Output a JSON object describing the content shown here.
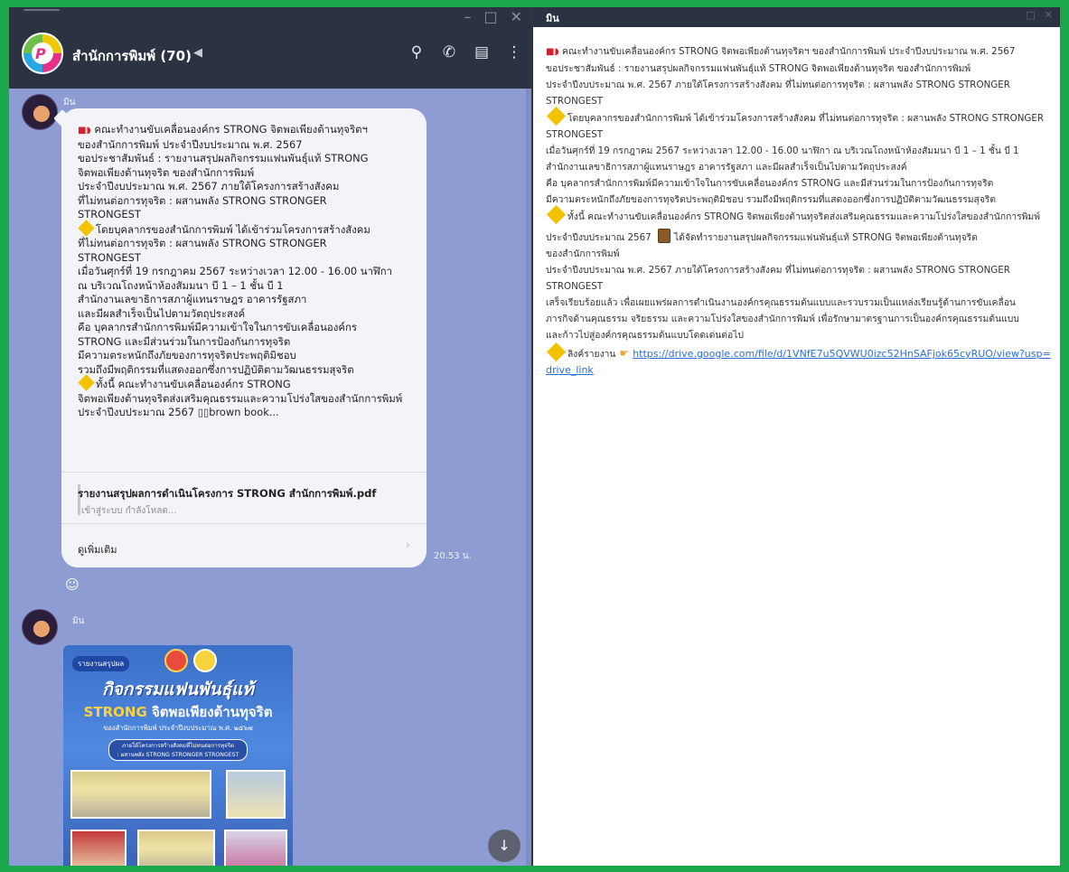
{
  "chat": {
    "title": "สำนักการพิมพ์ (70)",
    "sender": "มิน",
    "time": "20.53 น.",
    "bubble": {
      "lines": [
        "คณะทำงานขับเคลื่อนองค์กร STRONG จิตพอเพียงต้านทุจริตฯ",
        "ของสำนักการพิมพ์ ประจำปีงบประมาณ พ.ศ. 2567",
        "ขอประชาสัมพันธ์ : รายงานสรุปผลกิจกรรมแฟนพันธุ์แท้ STRONG",
        "จิตพอเพียงต้านทุจริต ของสำนักการพิมพ์",
        "ประจำปีงบประมาณ พ.ศ. 2567 ภายใต้โครงการสร้างสังคม",
        "ที่ไม่ทนต่อการทุจริต : ผสานพลัง STRONG STRONGER",
        "STRONGEST",
        "โดยบุคลากรของสำนักการพิมพ์ ได้เข้าร่วมโครงการสร้างสังคม",
        "ที่ไม่ทนต่อการทุจริต : ผสานพลัง STRONG STRONGER",
        "STRONGEST",
        "เมื่อวันศุกร์ที่ 19 กรกฎาคม 2567 ระหว่างเวลา 12.00 - 16.00 นาฬิกา",
        "ณ บริเวณโถงหน้าห้องสัมมนา บี 1 – 1 ชั้น บี 1",
        "สำนักงานเลขาธิการสภาผู้แทนราษฎร อาคารรัฐสภา",
        "และมีผลสำเร็จเป็นไปตามวัตถุประสงค์",
        "คือ บุคลากรสำนักการพิมพ์มีความเข้าใจในการขับเคลื่อนองค์กร",
        "STRONG และมีส่วนร่วมในการป้องกันการทุจริต",
        "มีความตระหนักถึงภัยของการทุจริตประพฤติมิชอบ",
        "รวมถึงมีพฤติกรรมที่แสดงออกซึ่งการปฏิบัติตามวัฒนธรรมสุจริต",
        "ทั้งนี้ คณะทำงานขับเคลื่อนองค์กร STRONG",
        "จิตพอเพียงต้านทุจริตส่งเสริมคุณธรรมและความโปร่งใสของสำนักการพิมพ์",
        "ประจำปีงบประมาณ 2567 ▯▯brown book..."
      ],
      "attachment_title": "รายงานสรุปผลการดำเนินโครงการ STRONG สำนักการพิมพ์.pdf",
      "attachment_status": "เข้าสู่ระบบ กำลังโหลด...",
      "see_more": "ดูเพิ่มเติม"
    },
    "second_sender": "มิน",
    "poster": {
      "tag": "รายงานสรุปผล",
      "heading": "กิจกรรมแฟนพันธุ์แท้",
      "heading2_strong": "STRONG",
      "heading2_rest": " จิตพอเพียงต้านทุจริต",
      "subheading": "ของสำนักการพิมพ์ ประจำปีงบประมาณ พ.ศ. ๒๕๖๗",
      "box_line1": "ภายใต้โครงการสร้างสังคมที่ไม่ทนต่อการทุจริต",
      "box_line2": ": ผสานพลัง STRONG STRONGER STRONGEST"
    },
    "icons": {
      "search": "⚲",
      "call": "✆",
      "notes": "▤",
      "more": "⋮",
      "speaker": "◀",
      "reaction": "☺",
      "scroll_down": "↓",
      "chevron": "›"
    },
    "window_controls": [
      "–",
      "□",
      "✕"
    ]
  },
  "detail": {
    "title": "มิน",
    "paragraphs": [
      "คณะทำงานขับเคลื่อนองค์กร STRONG จิตพอเพียงต้านทุจริตฯ ของสำนักการพิมพ์ ประจำปีงบประมาณ พ.ศ. 2567",
      "ขอประชาสัมพันธ์ : รายงานสรุปผลกิจกรรมแฟนพันธุ์แท้ STRONG จิตพอเพียงต้านทุจริต ของสำนักการพิมพ์",
      "ประจำปีงบประมาณ พ.ศ. 2567 ภายใต้โครงการสร้างสังคม ที่ไม่ทนต่อการทุจริต : ผสานพลัง STRONG STRONGER STRONGEST",
      "โดยบุคลากรของสำนักการพิมพ์ ได้เข้าร่วมโครงการสร้างสังคม ที่ไม่ทนต่อการทุจริต : ผสานพลัง STRONG STRONGER STRONGEST",
      "เมื่อวันศุกร์ที่ 19 กรกฎาคม 2567 ระหว่างเวลา 12.00 - 16.00 นาฬิกา ณ บริเวณโถงหน้าห้องสัมมนา บี 1 – 1 ชั้น บี 1",
      "สำนักงานเลขาธิการสภาผู้แทนราษฎร อาคารรัฐสภา และมีผลสำเร็จเป็นไปตามวัตถุประสงค์",
      "คือ บุคลากรสำนักการพิมพ์มีความเข้าใจในการขับเคลื่อนองค์กร STRONG และมีส่วนร่วมในการป้องกันการทุจริต",
      "มีความตระหนักถึงภัยของการทุจริตประพฤติมิชอบ รวมถึงมีพฤติกรรมที่แสดงออกซึ่งการปฏิบัติตามวัฒนธรรมสุจริต",
      "ทั้งนี้ คณะทำงานขับเคลื่อนองค์กร STRONG จิตพอเพียงต้านทุจริตส่งเสริมคุณธรรมและความโปร่งใสของสำนักการพิมพ์",
      "ประจำปีงบประมาณ 2567",
      "ได้จัดทำรายงานสรุปผลกิจกรรมแฟนพันธุ์แท้ STRONG จิตพอเพียงต้านทุจริต",
      "ของสำนักการพิมพ์",
      "ประจำปีงบประมาณ พ.ศ. 2567 ภายใต้โครงการสร้างสังคม ที่ไม่ทนต่อการทุจริต : ผสานพลัง STRONG STRONGER STRONGEST",
      "เสร็จเรียบร้อยแล้ว เพื่อเผยแพร่ผลการดำเนินงานองค์กรคุณธรรมต้นแบบและรวบรวมเป็นแหล่งเรียนรู้ด้านการขับเคลื่อน",
      "ภารกิจด้านคุณธรรม จริยธรรม และความโปร่งใสของสำนักการพิมพ์ เพื่อรักษามาตรฐานการเป็นองค์กรคุณธรรมต้นแบบ",
      "และก้าวไปสู่องค์กรคุณธรรมต้นแบบโดดเด่นต่อไป",
      "ลิงค์รายงาน"
    ],
    "link": "https://drive.google.com/file/d/1VNfE7u5QVWU0izc52HnSAFjok65cyRUO/view?usp=drive_link",
    "window_controls": [
      "□",
      "✕"
    ]
  },
  "colors": {
    "accent_green": "#1aa84a",
    "chat_bg": "#8d9dd3",
    "header_bg": "#2b3241",
    "diamond": "#f3c200",
    "link": "#2a6edc"
  }
}
